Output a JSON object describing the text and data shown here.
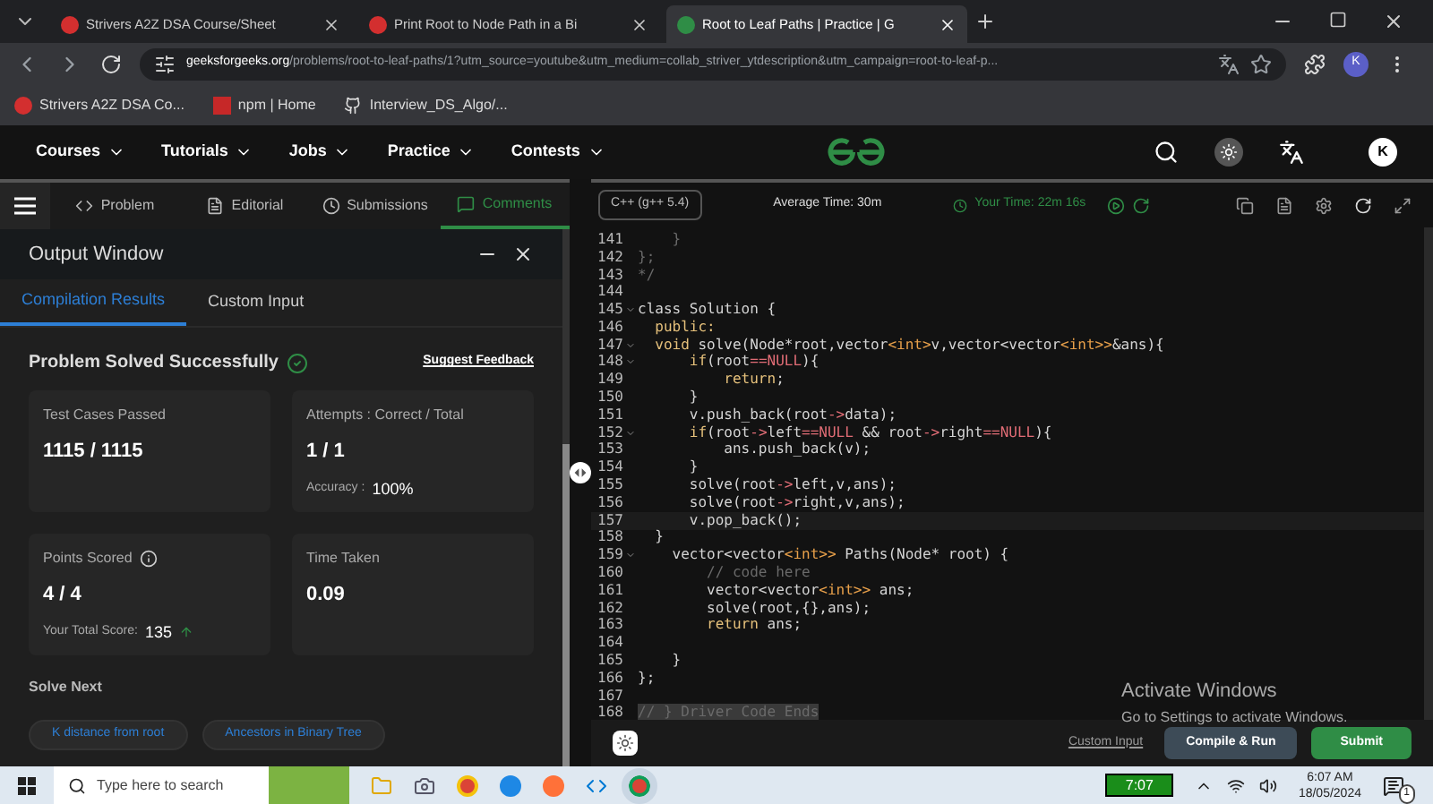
{
  "browser": {
    "tabs": [
      {
        "title": "Strivers A2Z DSA Course/Sheet",
        "selected": false
      },
      {
        "title": "Print Root to Node Path in a Bi",
        "selected": false
      },
      {
        "title": "Root to Leaf Paths | Practice | G",
        "selected": true
      }
    ],
    "url_host": "geeksforgeeks.org",
    "url_path": "/problems/root-to-leaf-paths/1?utm_source=youtube&utm_medium=collab_striver_ytdescription&utm_campaign=root-to-leaf-p...",
    "profile": "K",
    "bookmarks": [
      "Strivers A2Z DSA Co...",
      "npm | Home",
      "Interview_DS_Algo/..."
    ]
  },
  "site_nav": {
    "items": [
      "Courses",
      "Tutorials",
      "Jobs",
      "Practice",
      "Contests"
    ],
    "avatar": "K"
  },
  "problem_tabs": [
    {
      "label": "Problem",
      "selected": false
    },
    {
      "label": "Editorial",
      "selected": false
    },
    {
      "label": "Submissions",
      "selected": false
    },
    {
      "label": "Comments",
      "selected": true
    }
  ],
  "output_window": {
    "title": "Output Window",
    "tabs": [
      {
        "label": "Compilation Results",
        "selected": true
      },
      {
        "label": "Custom Input",
        "selected": false
      }
    ],
    "status": "Problem Solved Successfully",
    "feedback": "Suggest Feedback",
    "cards": [
      {
        "label": "Test Cases Passed",
        "value": "1115 / 1115"
      },
      {
        "label": "Attempts : Correct / Total",
        "value": "1 / 1",
        "sub_label": "Accuracy :",
        "sub_value": "100%"
      },
      {
        "label": "Points Scored",
        "value": "4 / 4",
        "info": true,
        "sub_label": "Your Total Score:",
        "sub_value": "135",
        "rising": true
      },
      {
        "label": "Time Taken",
        "value": "0.09"
      }
    ],
    "solve_next": "Solve Next",
    "next_problems": [
      "K distance from root",
      "Ancestors in Binary Tree"
    ]
  },
  "editor": {
    "language": "C++ (g++ 5.4)",
    "average_time": "Average Time: 30m",
    "your_time": "Your Time: 22m 16s",
    "lines": [
      {
        "number": "141",
        "fold": false,
        "tokens": [
          {
            "text": "    }",
            "kind": "comment"
          }
        ]
      },
      {
        "number": "142",
        "fold": false,
        "tokens": [
          {
            "text": "};",
            "kind": "comment"
          }
        ]
      },
      {
        "number": "143",
        "fold": false,
        "tokens": [
          {
            "text": "*/",
            "kind": "comment"
          }
        ]
      },
      {
        "number": "144",
        "fold": false
      },
      {
        "number": "145",
        "fold": true,
        "tokens": [
          {
            "text": "class Solution {",
            "kind": "plain"
          }
        ]
      },
      {
        "number": "146",
        "fold": false,
        "tokens": [
          {
            "text": "  public:",
            "kind": "keyword"
          }
        ]
      },
      {
        "number": "147",
        "fold": true,
        "tokens": [
          {
            "text": "  void",
            "kind": "keyword"
          },
          {
            "text": " solve(Node*root,vector",
            "kind": "plain"
          },
          {
            "text": "<int>",
            "kind": "type"
          },
          {
            "text": "v,vector<vector",
            "kind": "plain"
          },
          {
            "text": "<int>>",
            "kind": "type"
          },
          {
            "text": "&ans){",
            "kind": "plain"
          }
        ]
      },
      {
        "number": "148",
        "fold": true,
        "tokens": [
          {
            "text": "      if",
            "kind": "keyword"
          },
          {
            "text": "(root",
            "kind": "plain"
          },
          {
            "text": "==NULL",
            "kind": "constant"
          },
          {
            "text": "){",
            "kind": "plain"
          }
        ]
      },
      {
        "number": "149",
        "fold": false,
        "tokens": [
          {
            "text": "          return",
            "kind": "keyword"
          },
          {
            "text": ";",
            "kind": "plain"
          }
        ]
      },
      {
        "number": "150",
        "fold": false,
        "tokens": [
          {
            "text": "      }",
            "kind": "plain"
          }
        ]
      },
      {
        "number": "151",
        "fold": false,
        "tokens": [
          {
            "text": "      v.push_back(root",
            "kind": "plain"
          },
          {
            "text": "->",
            "kind": "constant"
          },
          {
            "text": "data);",
            "kind": "plain"
          }
        ]
      },
      {
        "number": "152",
        "fold": true,
        "tokens": [
          {
            "text": "      if",
            "kind": "keyword"
          },
          {
            "text": "(root",
            "kind": "plain"
          },
          {
            "text": "->",
            "kind": "constant"
          },
          {
            "text": "left",
            "kind": "plain"
          },
          {
            "text": "==NULL",
            "kind": "constant"
          },
          {
            "text": " && root",
            "kind": "plain"
          },
          {
            "text": "->",
            "kind": "constant"
          },
          {
            "text": "right",
            "kind": "plain"
          },
          {
            "text": "==NULL",
            "kind": "constant"
          },
          {
            "text": "){",
            "kind": "plain"
          }
        ]
      },
      {
        "number": "153",
        "fold": false,
        "tokens": [
          {
            "text": "          ans.push_back(v);",
            "kind": "plain"
          }
        ]
      },
      {
        "number": "154",
        "fold": false,
        "tokens": [
          {
            "text": "      }",
            "kind": "plain"
          }
        ]
      },
      {
        "number": "155",
        "fold": false,
        "tokens": [
          {
            "text": "      solve(root",
            "kind": "plain"
          },
          {
            "text": "->",
            "kind": "constant"
          },
          {
            "text": "left,v,ans);",
            "kind": "plain"
          }
        ]
      },
      {
        "number": "156",
        "fold": false,
        "tokens": [
          {
            "text": "      solve(root",
            "kind": "plain"
          },
          {
            "text": "->",
            "kind": "constant"
          },
          {
            "text": "right,v,ans);",
            "kind": "plain"
          }
        ]
      },
      {
        "number": "157",
        "fold": false,
        "tokens": [
          {
            "text": "      v.pop_back();",
            "kind": "plain"
          }
        ]
      },
      {
        "number": "158",
        "fold": false,
        "tokens": [
          {
            "text": "  }",
            "kind": "plain"
          }
        ]
      },
      {
        "number": "159",
        "fold": true,
        "tokens": [
          {
            "text": "    vector<vector",
            "kind": "plain"
          },
          {
            "text": "<int>>",
            "kind": "type"
          },
          {
            "text": " Paths(Node* root) {",
            "kind": "plain"
          }
        ]
      },
      {
        "number": "160",
        "fold": false,
        "tokens": [
          {
            "text": "        // code here",
            "kind": "comment"
          }
        ]
      },
      {
        "number": "161",
        "fold": false,
        "tokens": [
          {
            "text": "        vector<vector",
            "kind": "plain"
          },
          {
            "text": "<int>>",
            "kind": "type"
          },
          {
            "text": " ans;",
            "kind": "plain"
          }
        ]
      },
      {
        "number": "162",
        "fold": false,
        "tokens": [
          {
            "text": "        solve(root,{},ans);",
            "kind": "plain"
          }
        ]
      },
      {
        "number": "163",
        "fold": false,
        "tokens": [
          {
            "text": "        return",
            "kind": "keyword"
          },
          {
            "text": " ans;",
            "kind": "plain"
          }
        ]
      },
      {
        "number": "164",
        "fold": false
      },
      {
        "number": "165",
        "fold": false,
        "tokens": [
          {
            "text": "    }",
            "kind": "plain"
          }
        ]
      },
      {
        "number": "166",
        "fold": false,
        "tokens": [
          {
            "text": "};",
            "kind": "plain"
          }
        ]
      },
      {
        "number": "167",
        "fold": false
      },
      {
        "number": "168",
        "fold": false,
        "tokens": [
          {
            "text": "// } Driver Code Ends",
            "kind": "folded"
          }
        ]
      }
    ],
    "buttons": [
      {
        "label": "Custom Input",
        "kind": "link"
      },
      {
        "label": "Compile & Run",
        "kind": "secondary"
      },
      {
        "label": "Submit",
        "kind": "primary"
      }
    ]
  },
  "activation": {
    "title": "Activate Windows",
    "message": "Go to Settings to activate Windows."
  },
  "taskbar": {
    "search_placeholder": "Type here to search",
    "battery": "7:07",
    "time": "6:07 AM",
    "date": "18/05/2024",
    "notifications": "1"
  }
}
